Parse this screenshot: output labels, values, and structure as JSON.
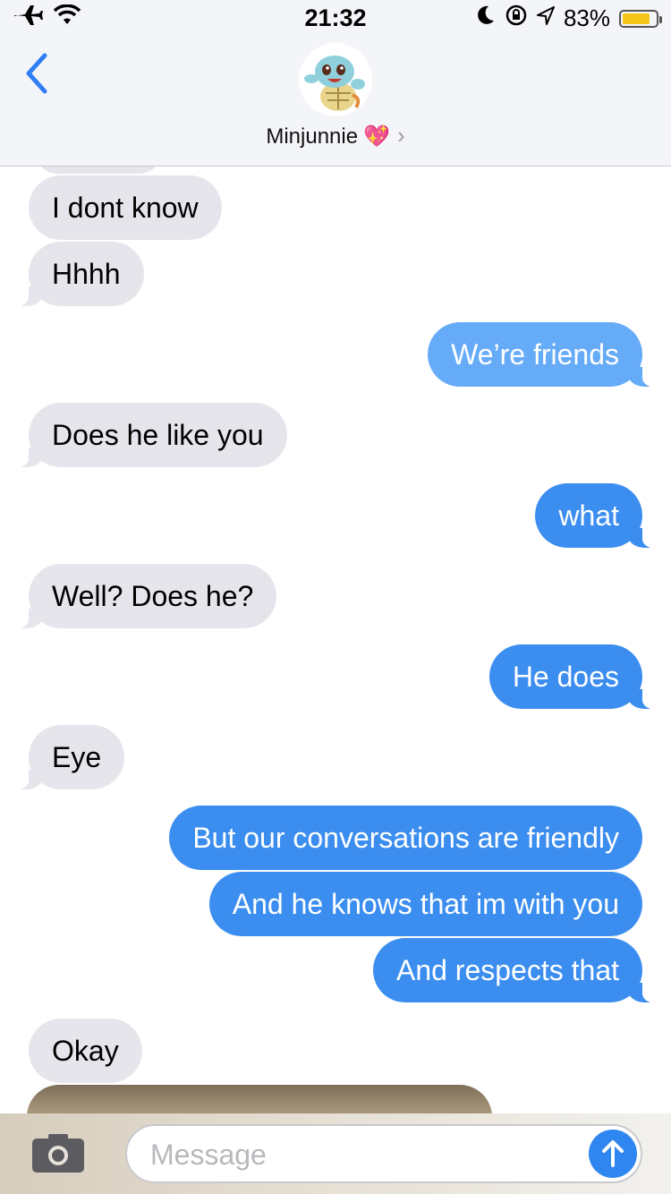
{
  "status_bar": {
    "time": "21:32",
    "battery_percent": "83%",
    "battery_level": 0.83,
    "icons": [
      "airplane-icon",
      "wifi-icon",
      "moon-icon",
      "rotation-lock-icon",
      "location-icon",
      "battery-icon"
    ]
  },
  "header": {
    "contact_name": "Minjunnie",
    "contact_emoji": "💖",
    "chevron": "›",
    "colors": {
      "back": "#2f7ef5",
      "header_bg": "#f4f5f8"
    }
  },
  "messages": [
    {
      "side": "in",
      "text": "I dont know"
    },
    {
      "side": "in",
      "text": "Hhhh"
    },
    {
      "side": "out",
      "text": "We’re friends"
    },
    {
      "side": "in",
      "text": "Does he like you"
    },
    {
      "side": "out",
      "text": "what"
    },
    {
      "side": "in",
      "text": "Well? Does he?"
    },
    {
      "side": "out",
      "text": "He does"
    },
    {
      "side": "in",
      "text": "Eye"
    },
    {
      "side": "out",
      "text": "But our conversations are friendly"
    },
    {
      "side": "out",
      "text": "And he knows that im with you"
    },
    {
      "side": "out",
      "text": "And respects that"
    },
    {
      "side": "in",
      "text": "Okay"
    }
  ],
  "composer": {
    "placeholder": "Message",
    "value": ""
  },
  "colors": {
    "incoming": "#e6e5eb",
    "outgoing": "#3b8ef0",
    "send": "#2f86f0"
  }
}
